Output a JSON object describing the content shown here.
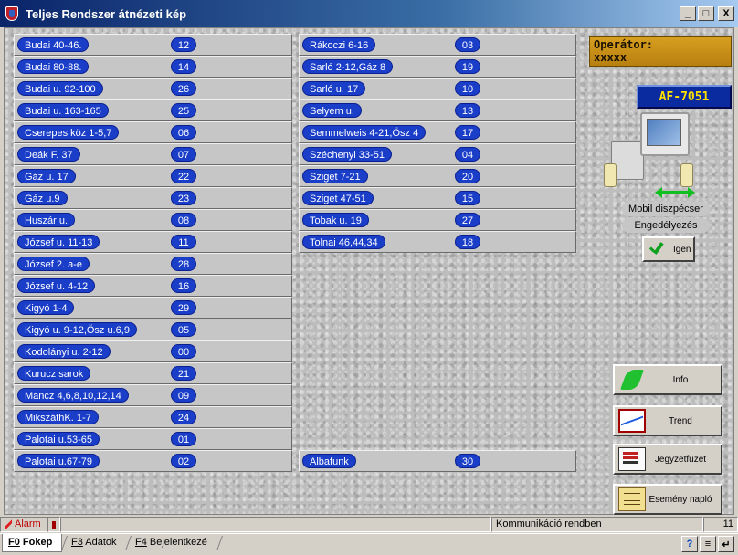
{
  "window": {
    "title": "Teljes Rendszer átnézeti kép",
    "minimize": "_",
    "maximize": "□",
    "close": "X"
  },
  "left_list": [
    {
      "name": "Budai 40-46.",
      "num": "12"
    },
    {
      "name": "Budai 80-88.",
      "num": "14"
    },
    {
      "name": "Budai u. 92-100",
      "num": "26"
    },
    {
      "name": "Budai u. 163-165",
      "num": "25"
    },
    {
      "name": "Cserepes köz 1-5,7",
      "num": "06"
    },
    {
      "name": "Deák F. 37",
      "num": "07"
    },
    {
      "name": "Gáz u. 17",
      "num": "22"
    },
    {
      "name": "Gáz u.9",
      "num": "23"
    },
    {
      "name": "Huszár u.",
      "num": "08"
    },
    {
      "name": "József u. 11-13",
      "num": "11"
    },
    {
      "name": "József 2. a-e",
      "num": "28"
    },
    {
      "name": "József u. 4-12",
      "num": "16"
    },
    {
      "name": "Kigyó 1-4",
      "num": "29"
    },
    {
      "name": "Kigyó u. 9-12,Ösz u.6,9",
      "num": "05"
    },
    {
      "name": "Kodolányi u. 2-12",
      "num": "00"
    },
    {
      "name": "Kurucz sarok",
      "num": "21"
    },
    {
      "name": "Mancz 4,6,8,10,12,14",
      "num": "09"
    },
    {
      "name": "MikszáthK. 1-7",
      "num": "24"
    },
    {
      "name": "Palotai u.53-65",
      "num": "01"
    },
    {
      "name": "Palotai u.67-79",
      "num": "02"
    }
  ],
  "mid_list": [
    {
      "name": "Rákoczi 6-16",
      "num": "03"
    },
    {
      "name": "Sarló 2-12,Gáz 8",
      "num": "19"
    },
    {
      "name": "Sarló u. 17",
      "num": "10"
    },
    {
      "name": "Selyem u.",
      "num": "13"
    },
    {
      "name": "Semmelweis 4-21,Ösz 4",
      "num": "17"
    },
    {
      "name": "Széchenyi 33-51",
      "num": "04"
    },
    {
      "name": "Sziget 7-21",
      "num": "20"
    },
    {
      "name": "Sziget 47-51",
      "num": "15"
    },
    {
      "name": "Tobak u. 19",
      "num": "27"
    },
    {
      "name": "Tolnai 46,44,34",
      "num": "18"
    }
  ],
  "albafunk": {
    "name": "Albafunk",
    "num": "30"
  },
  "operator": {
    "label": "Operátor:",
    "value": "xxxxx"
  },
  "device_id": "AF-7051",
  "mobil_label": "Mobil diszpécser",
  "engedely_label": "Engedélyezés",
  "igen_label": "Igen",
  "buttons": {
    "info": "Info",
    "trend": "Trend",
    "jegyzet": "Jegyzetfüzet",
    "esemeny": "Esemény napló"
  },
  "status": {
    "alarm": "Alarm",
    "comm": "Kommunikáció rendben",
    "count": "11"
  },
  "tabs": {
    "fokep_key": "F0",
    "fokep": " Fokep",
    "adatok_key": "F3",
    "adatok": " Adatok",
    "bejel_key": "F4",
    "bejel": " Bejelentkezé"
  },
  "toolbar": {
    "help": "?",
    "doc": "≡",
    "enter": "↵"
  }
}
